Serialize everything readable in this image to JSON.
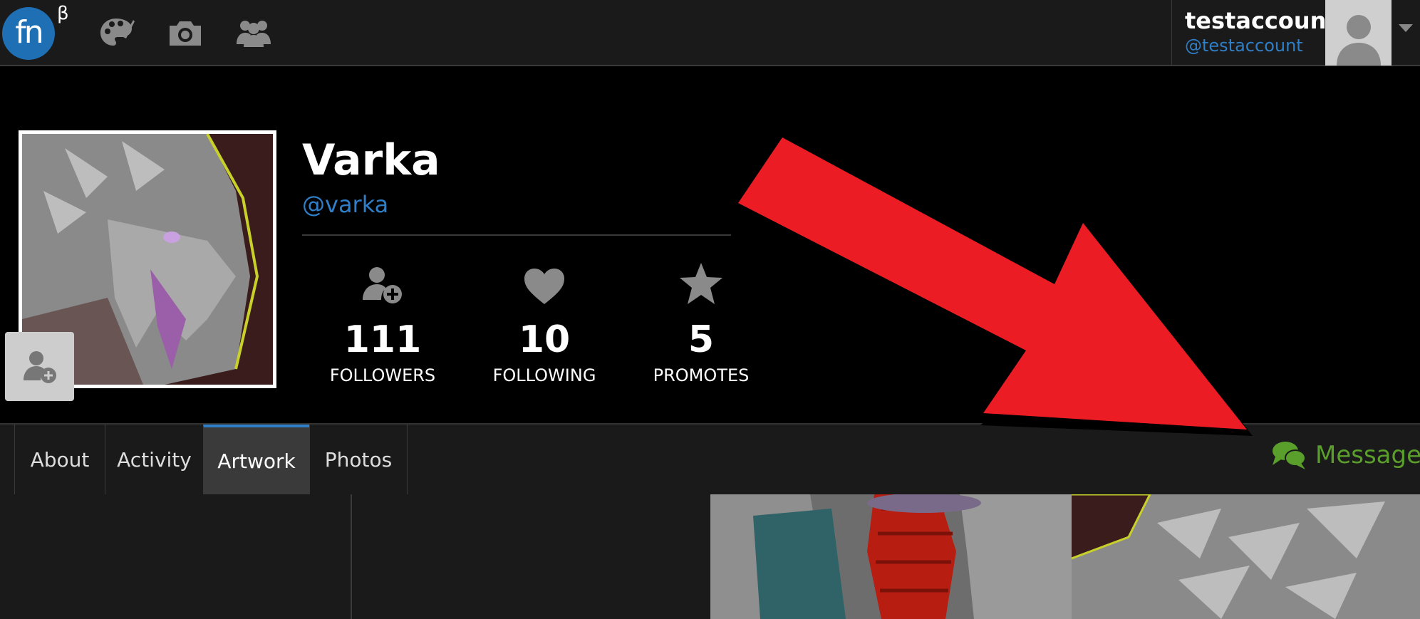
{
  "topbar": {
    "logo_text": "fn",
    "beta_mark": "β",
    "nav_icons": [
      "palette-icon",
      "camera-icon",
      "group-icon"
    ],
    "user": {
      "name": "testaccount",
      "handle": "@testaccount"
    }
  },
  "profile": {
    "name": "Varka",
    "handle": "@varka",
    "stats": [
      {
        "icon": "add-user-icon",
        "value": "111",
        "label": "FOLLOWERS"
      },
      {
        "icon": "heart-icon",
        "value": "10",
        "label": "FOLLOWING"
      },
      {
        "icon": "star-icon",
        "value": "5",
        "label": "PROMOTES"
      }
    ]
  },
  "tabs": [
    {
      "label": "About",
      "active": false
    },
    {
      "label": "Activity",
      "active": false
    },
    {
      "label": "Artwork",
      "active": true
    },
    {
      "label": "Photos",
      "active": false
    }
  ],
  "message_label": "Message",
  "colors": {
    "accent_blue": "#2f7fc8",
    "message_green": "#5a9e2b",
    "arrow_red": "#ec1c24"
  }
}
